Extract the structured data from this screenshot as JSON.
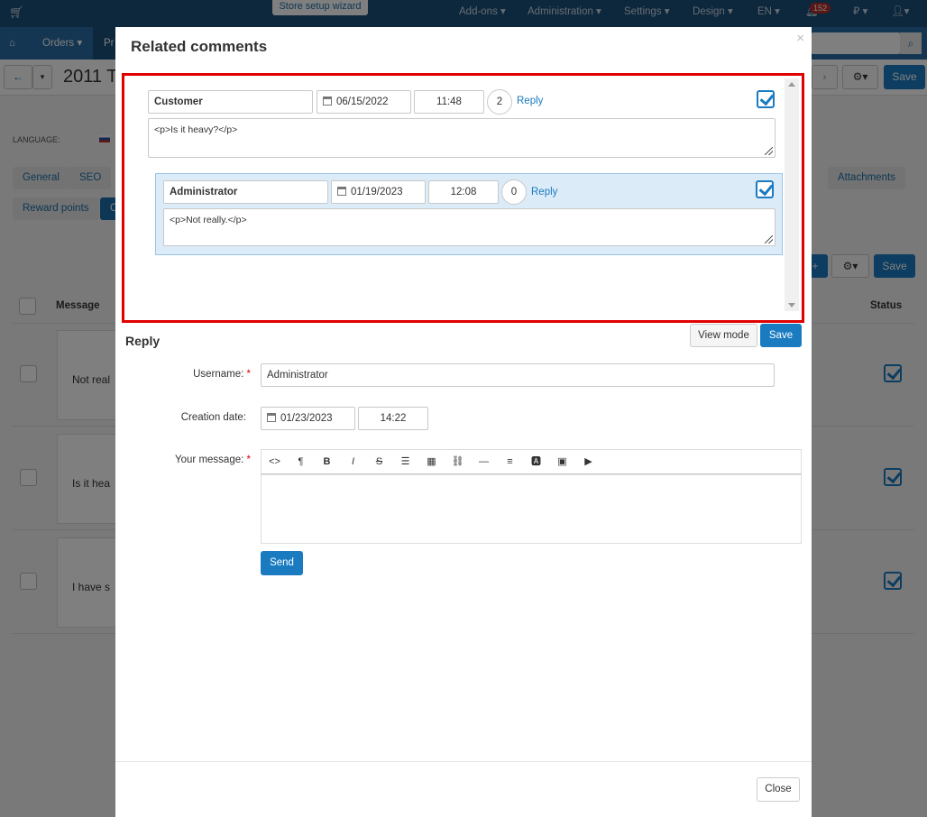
{
  "topbar": {
    "wizard_label": "Store setup wizard",
    "items": [
      "Add-ons ▾",
      "Administration ▾",
      "Settings ▾",
      "Design ▾",
      "EN ▾",
      "₽ ▾"
    ],
    "notification_count": "152"
  },
  "navbar": {
    "orders_label": "Orders ▾",
    "products_label": "Pr"
  },
  "page": {
    "title": "2011 T",
    "save_label": "Save",
    "language_label": "LANGUAGE:",
    "tabs_row1": [
      "General",
      "SEO",
      "Attachments"
    ],
    "tabs_row2": [
      "Reward points",
      "C"
    ],
    "save2_label": "Save",
    "col_message": "Message",
    "col_status": "Status",
    "rows": [
      {
        "text": "Not real"
      },
      {
        "text": "Is it hea"
      },
      {
        "text": "I have s"
      }
    ]
  },
  "modal": {
    "title": "Related comments",
    "close_symbol": "×",
    "comments": [
      {
        "username": "Customer",
        "date": "06/15/2022",
        "time": "11:48",
        "reply_count": "2",
        "reply_label": "Reply",
        "message": "<p>Is it heavy?</p>"
      },
      {
        "username": "Administrator",
        "date": "01/19/2023",
        "time": "12:08",
        "reply_count": "0",
        "reply_label": "Reply",
        "message": "<p>Not really.</p>"
      }
    ],
    "reply_section": {
      "heading": "Reply",
      "view_mode_label": "View mode",
      "save_label": "Save",
      "username_label": "Username:",
      "username_value": "Administrator",
      "creation_date_label": "Creation date:",
      "date_value": "01/23/2023",
      "time_value": "14:22",
      "message_label": "Your message:",
      "send_label": "Send"
    },
    "footer_close_label": "Close"
  },
  "colors": {
    "accent": "#1a7bc1",
    "highlight_border": "#e00000",
    "topbar": "#1a4f7a",
    "reply_block_bg": "#dcebf8"
  }
}
